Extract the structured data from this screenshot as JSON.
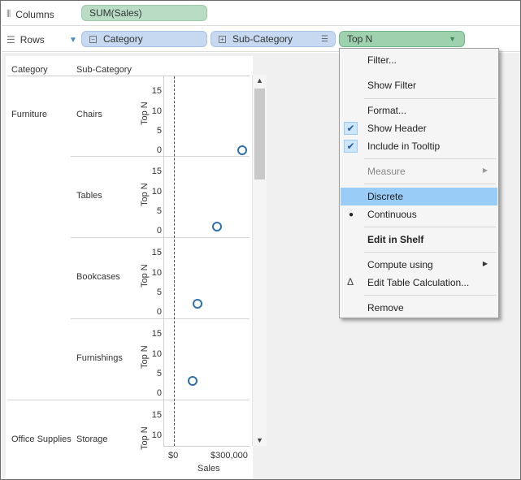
{
  "shelves": {
    "columns": {
      "label": "Columns",
      "pill": "SUM(Sales)"
    },
    "rows": {
      "label": "Rows",
      "pills": [
        "Category",
        "Sub-Category",
        "Top N"
      ]
    }
  },
  "view": {
    "headers": {
      "category": "Category",
      "sub_category": "Sub-Category"
    },
    "categories": [
      "Furniture",
      "Office Supplies"
    ],
    "sub_categories": [
      "Chairs",
      "Tables",
      "Bookcases",
      "Furnishings",
      "Storage"
    ],
    "y_axis_title": "Top N",
    "y_ticks": [
      "15",
      "10",
      "5",
      "0"
    ],
    "x_ticks": [
      "$0",
      "$300,000"
    ],
    "x_axis_title": "Sales"
  },
  "chart_data": {
    "type": "scatter",
    "xlabel": "Sales",
    "ylabel": "Top N",
    "ylim": [
      0,
      15
    ],
    "points": [
      {
        "category": "Furniture",
        "sub_category": "Chairs",
        "sales": 330000,
        "top_n": 0
      },
      {
        "category": "Furniture",
        "sub_category": "Tables",
        "sales": 207000,
        "top_n": 1
      },
      {
        "category": "Furniture",
        "sub_category": "Bookcases",
        "sales": 115000,
        "top_n": 2
      },
      {
        "category": "Furniture",
        "sub_category": "Furnishings",
        "sales": 92000,
        "top_n": 3
      }
    ]
  },
  "context_menu": {
    "items": [
      {
        "label": "Filter...",
        "type": "item"
      },
      {
        "label": "Show Filter",
        "type": "item"
      },
      {
        "label": "Format...",
        "type": "item"
      },
      {
        "label": "Show Header",
        "type": "item",
        "checked": true
      },
      {
        "label": "Include in Tooltip",
        "type": "item",
        "checked": true
      },
      {
        "label": "Measure",
        "type": "submenu",
        "disabled": true
      },
      {
        "label": "Discrete",
        "type": "item",
        "highlighted": true
      },
      {
        "label": "Continuous",
        "type": "item",
        "bullet": true
      },
      {
        "label": "Edit in Shelf",
        "type": "item",
        "bold": true
      },
      {
        "label": "Compute using",
        "type": "submenu"
      },
      {
        "label": "Edit Table Calculation...",
        "type": "item",
        "icon": "delta-icon"
      },
      {
        "label": "Remove",
        "type": "item"
      }
    ]
  },
  "colors": {
    "mark": "#2f6fae",
    "highlight": "#99ccf6",
    "green_pill": "#b9ddc4",
    "blue_pill": "#c6d9f0"
  }
}
